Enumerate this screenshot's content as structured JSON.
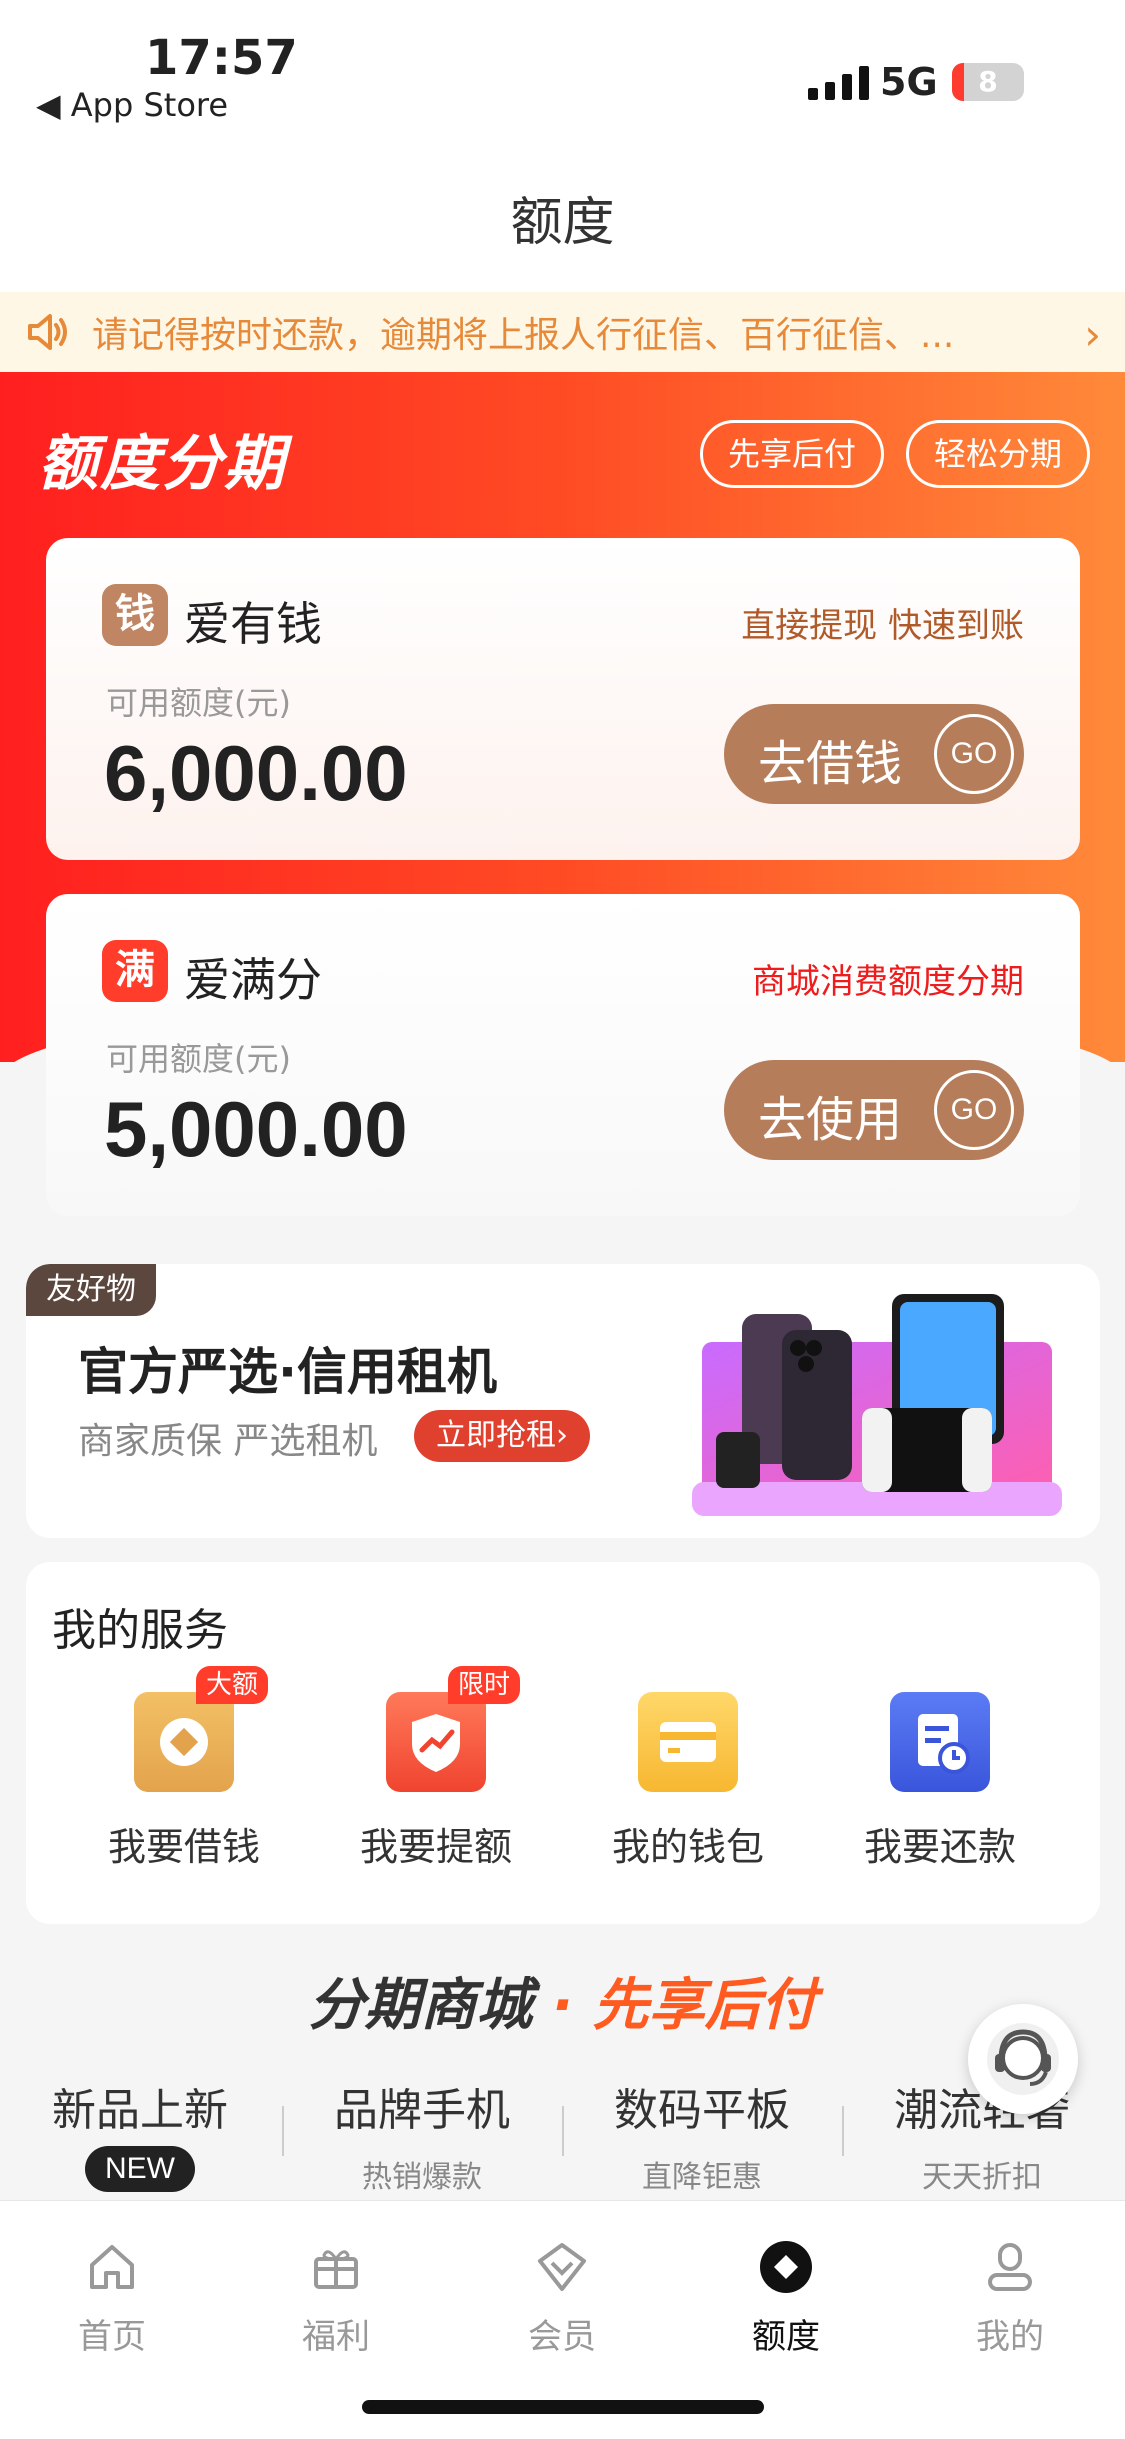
{
  "status_bar": {
    "time": "17:57",
    "back_label": "◀ App Store",
    "network": "5G",
    "battery": "8"
  },
  "header": {
    "title": "额度"
  },
  "notice": {
    "text": "请记得按时还款，逾期将上报人行征信、百行征信、...",
    "arrow": "›"
  },
  "hero": {
    "title": "额度分期",
    "pills": [
      "先享后付",
      "轻松分期"
    ]
  },
  "cards": [
    {
      "logo_char": "钱",
      "name": "爱有钱",
      "tagline": "直接提现 快速到账",
      "label": "可用额度(元)",
      "amount": "6,000.00",
      "button": "去借钱",
      "go": "GO"
    },
    {
      "logo_char": "满",
      "name": "爱满分",
      "tagline": "商城消费额度分期",
      "label": "可用额度(元)",
      "amount": "5,000.00",
      "button": "去使用",
      "go": "GO"
    }
  ],
  "promo": {
    "badge": "友好物",
    "title": "官方严选·信用租机",
    "subtitle": "商家质保 严选租机",
    "button": "立即抢租›"
  },
  "services": {
    "title": "我的服务",
    "items": [
      {
        "label": "我要借钱",
        "tag": "大额",
        "icon": "borrow-icon"
      },
      {
        "label": "我要提额",
        "tag": "限时",
        "icon": "raise-limit-icon"
      },
      {
        "label": "我的钱包",
        "tag": "",
        "icon": "wallet-icon"
      },
      {
        "label": "我要还款",
        "tag": "",
        "icon": "repay-icon"
      }
    ]
  },
  "mall": {
    "title_a": "分期商城",
    "title_dot": " · ",
    "title_b": "先享后付",
    "categories": [
      {
        "label": "新品上新",
        "sub": "NEW"
      },
      {
        "label": "品牌手机",
        "sub": "热销爆款"
      },
      {
        "label": "数码平板",
        "sub": "直降钜惠"
      },
      {
        "label": "潮流轻奢",
        "sub": "天天折扣"
      }
    ]
  },
  "tabbar": {
    "items": [
      {
        "label": "首页",
        "icon": "home-icon"
      },
      {
        "label": "福利",
        "icon": "gift-icon"
      },
      {
        "label": "会员",
        "icon": "diamond-icon"
      },
      {
        "label": "额度",
        "icon": "quota-icon"
      },
      {
        "label": "我的",
        "icon": "profile-icon"
      }
    ],
    "active": "额度"
  },
  "colors": {
    "brand_red": "#ff1f1f",
    "brand_orange": "#ff8a3a",
    "card_button": "#b67d5b",
    "notice_text": "#e68a3a"
  }
}
